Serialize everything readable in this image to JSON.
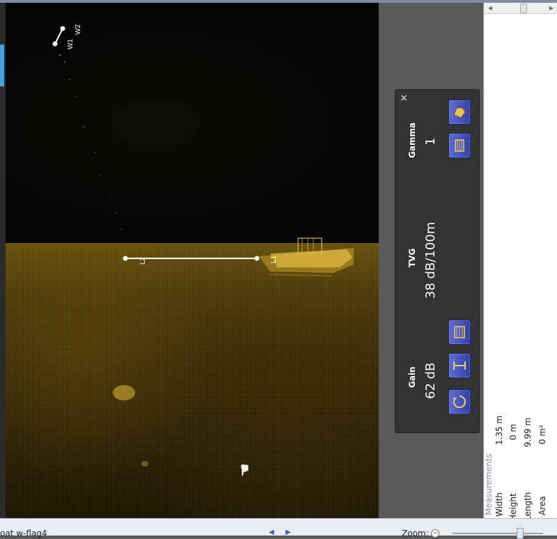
{
  "sonar": {
    "waypoints": {
      "w1_label": "W1",
      "w2_label": "W2"
    },
    "line_markers": {
      "start_label": "L2",
      "end_label": "L1"
    },
    "cursor_icon": "hand-cursor-icon"
  },
  "control_panel": {
    "close_label": "×",
    "gain": {
      "label": "Gain",
      "value": "62 dB"
    },
    "tvg": {
      "label": "TVG",
      "value": "38 dB/100m"
    },
    "gamma": {
      "label": "Gamma",
      "value": "1"
    },
    "buttons": [
      {
        "name": "reset-icon"
      },
      {
        "name": "gain-adjust-icon"
      },
      {
        "name": "tvg-adjust-icon"
      },
      {
        "name": "gamma-adjust-icon"
      },
      {
        "name": "palette-icon"
      }
    ]
  },
  "measurements": {
    "header": "Measurements",
    "rows": [
      {
        "label": "Width",
        "value": "1.35 m"
      },
      {
        "label": "Height",
        "value": "0 m"
      },
      {
        "label": "Length",
        "value": "9.99 m"
      },
      {
        "label": "Area",
        "value": "0 m²"
      }
    ]
  },
  "status_bar": {
    "file_name": "oat w-flag4",
    "zoom_label": "Zoom:",
    "zoom_minus": "−"
  },
  "colors": {
    "panel_bg": "#333333",
    "button_blue": "#4a56c0",
    "sonar_gold": "#c9a227",
    "accent_blue": "#4aa3d8"
  }
}
